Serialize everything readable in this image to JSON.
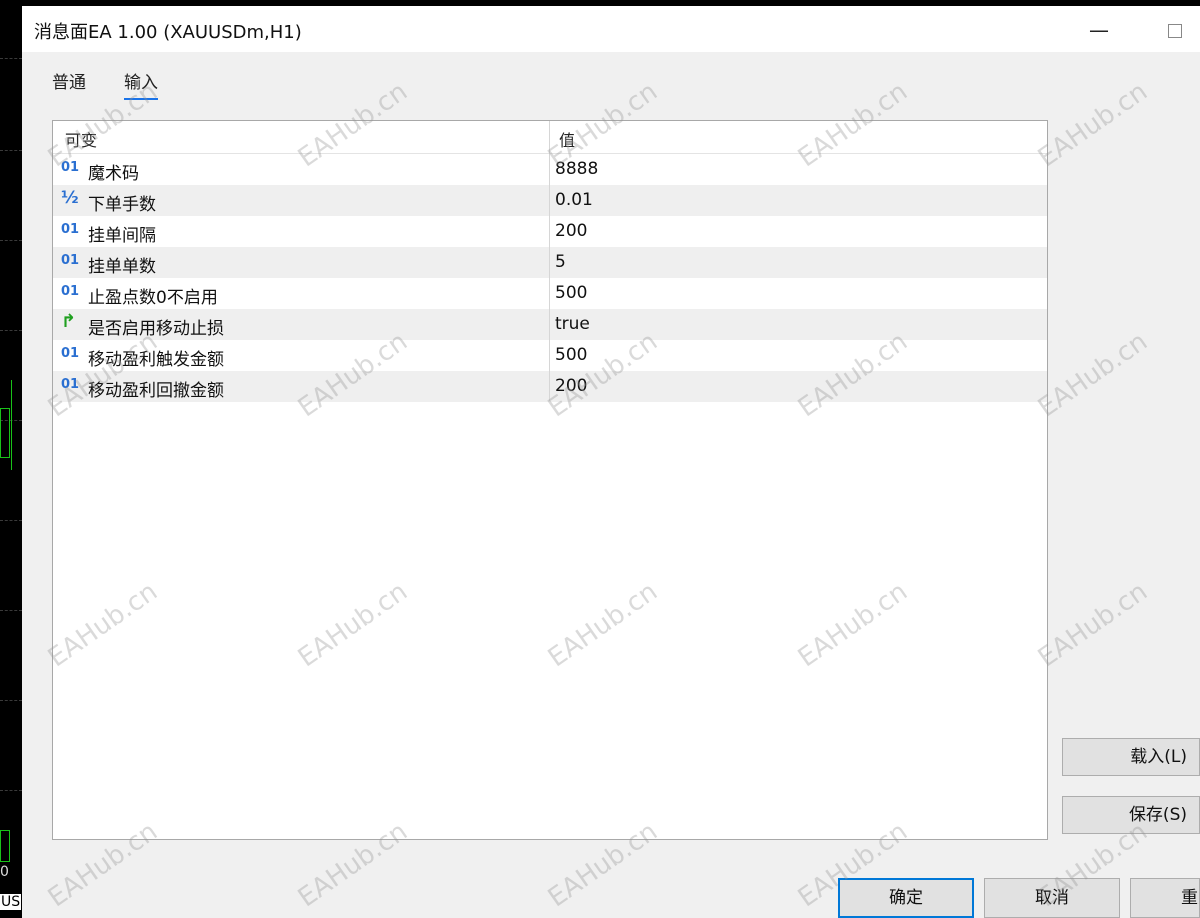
{
  "window": {
    "title": "消息面EA 1.00 (XAUUSDm,H1)",
    "minimize_glyph": "—"
  },
  "chart_edge": {
    "price_label": "0",
    "symbol_label": "US"
  },
  "tabs": [
    {
      "label": "普通",
      "active": false
    },
    {
      "label": "输入",
      "active": true
    }
  ],
  "table": {
    "headers": {
      "variable": "可变",
      "value": "值"
    },
    "rows": [
      {
        "icon": "01",
        "type": "int",
        "name": "魔术码",
        "value": "8888"
      },
      {
        "icon": "½",
        "type": "double",
        "name": "下单手数",
        "value": "0.01"
      },
      {
        "icon": "01",
        "type": "int",
        "name": "挂单间隔",
        "value": "200"
      },
      {
        "icon": "01",
        "type": "int",
        "name": "挂单单数",
        "value": "5"
      },
      {
        "icon": "01",
        "type": "int",
        "name": "止盈点数0不启用",
        "value": "500"
      },
      {
        "icon": "↱",
        "type": "bool",
        "name": "是否启用移动止损",
        "value": "true"
      },
      {
        "icon": "01",
        "type": "int",
        "name": "移动盈利触发金额",
        "value": "500"
      },
      {
        "icon": "01",
        "type": "int",
        "name": "移动盈利回撤金额",
        "value": "200"
      }
    ]
  },
  "side_buttons": {
    "load": "载入(L)",
    "save": "保存(S)"
  },
  "bottom_buttons": {
    "ok": "确定",
    "cancel": "取消",
    "reset": "重置"
  },
  "watermark": "EAHub.cn",
  "colors": {
    "accent": "#0078d7",
    "tab_underline": "#1a73e8",
    "int_icon": "#2a6fd1",
    "bool_icon": "#20a020"
  }
}
